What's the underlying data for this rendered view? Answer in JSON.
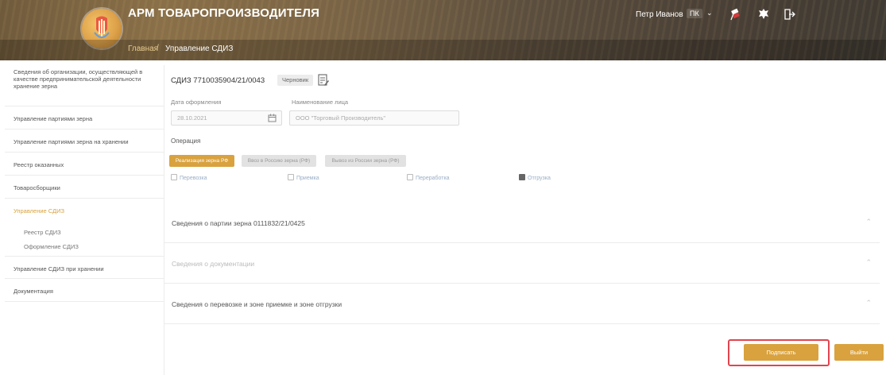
{
  "header": {
    "app_title": "АРМ ТОВАРОПРОИЗВОДИТЕЛЯ",
    "breadcrumb": {
      "home": "Главная",
      "separator": "/",
      "current": "Управление СДИЗ"
    },
    "user": {
      "name": "Петр Иванов",
      "role": "ПК",
      "chevron": "⌄"
    },
    "icons": [
      "flag-icon",
      "emblem-icon",
      "logout-icon"
    ],
    "accent_color": "#d9a23e"
  },
  "sidebar": {
    "items": [
      {
        "label": "Сведения об организации, осуществляющей в качестве предпринимательской деятельности хранение зерна"
      },
      {
        "label": "Управление партиями зерна"
      },
      {
        "label": "Управление партиями зерна на хранении"
      },
      {
        "label": "Реестр оказанных"
      },
      {
        "label": "Товаросборщики"
      },
      {
        "label": "Управление СДИЗ",
        "active": true
      },
      {
        "label": "Управление СДИЗ при хранении"
      },
      {
        "label": "Документация"
      }
    ],
    "sub_items": [
      {
        "label": "Реестр СДИЗ"
      },
      {
        "label": "Оформление СДИЗ"
      }
    ]
  },
  "main": {
    "doc_title": "СДИЗ 7710035904/21/0043",
    "badge": "Черновик",
    "fields": {
      "date_label": "Дата оформления",
      "date_value": "28.10.2021",
      "org_label": "Наименование лица",
      "org_value": "ООО \"Торговый Производитель\""
    },
    "operations_label": "Операция",
    "operations": [
      {
        "label": "Реализация зерна РФ",
        "active": true
      },
      {
        "label": "Ввоз в Россию зерна (РФ)",
        "active": false
      },
      {
        "label": "Вывоз из России зерна (РФ)",
        "active": false
      }
    ],
    "checks": [
      {
        "label": "Перевозка"
      },
      {
        "label": "Приемка"
      },
      {
        "label": "Переработка"
      },
      {
        "label": "Отгрузка"
      }
    ],
    "sections": [
      {
        "title": "Сведения о партии зерна 0111832/21/0425",
        "muted": false
      },
      {
        "title": "Сведения о документации",
        "muted": true
      },
      {
        "title": "Сведения о перевозке и зоне приемке и зоне отгрузки",
        "muted": false
      }
    ],
    "chevron": "⌃",
    "buttons": {
      "publish": "Подписать",
      "back": "Выйти"
    }
  }
}
